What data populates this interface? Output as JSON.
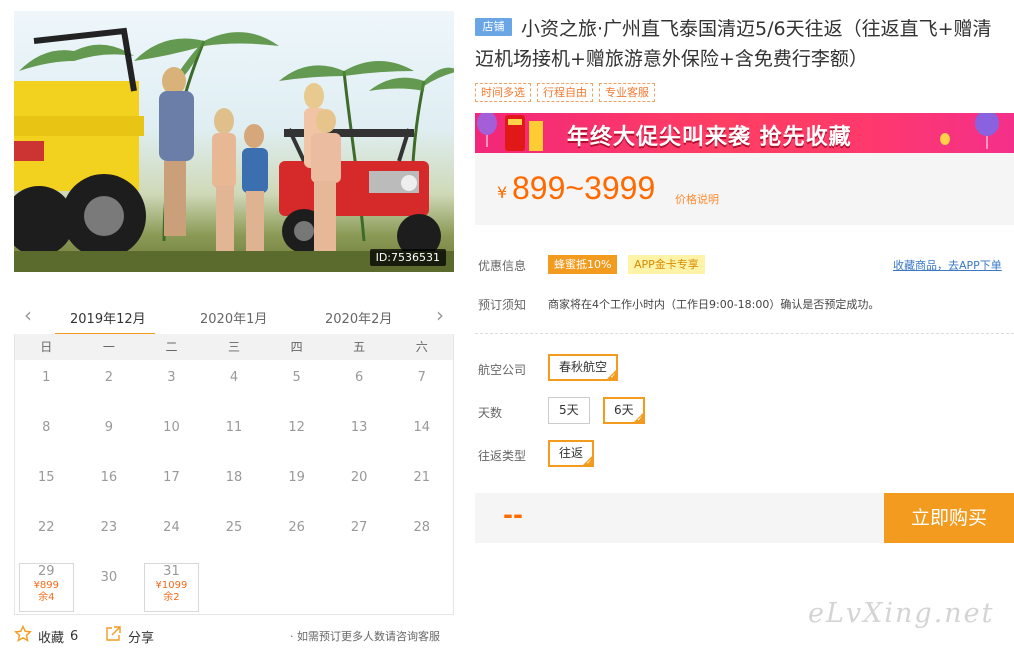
{
  "photo": {
    "id_label": "ID:7536531"
  },
  "calendar": {
    "months": [
      "2019年12月",
      "2020年1月",
      "2020年2月"
    ],
    "weekdays": [
      "日",
      "一",
      "二",
      "三",
      "四",
      "五",
      "六"
    ],
    "rows": [
      [
        {
          "d": "1"
        },
        {
          "d": "2"
        },
        {
          "d": "3"
        },
        {
          "d": "4"
        },
        {
          "d": "5"
        },
        {
          "d": "6"
        },
        {
          "d": "7"
        }
      ],
      [
        {
          "d": "8"
        },
        {
          "d": "9"
        },
        {
          "d": "10"
        },
        {
          "d": "11"
        },
        {
          "d": "12"
        },
        {
          "d": "13"
        },
        {
          "d": "14"
        }
      ],
      [
        {
          "d": "15"
        },
        {
          "d": "16"
        },
        {
          "d": "17"
        },
        {
          "d": "18"
        },
        {
          "d": "19"
        },
        {
          "d": "20"
        },
        {
          "d": "21"
        }
      ],
      [
        {
          "d": "22"
        },
        {
          "d": "23"
        },
        {
          "d": "24"
        },
        {
          "d": "25"
        },
        {
          "d": "26"
        },
        {
          "d": "27"
        },
        {
          "d": "28"
        }
      ],
      [
        {
          "d": "29",
          "price": "¥899",
          "stock": "余4"
        },
        {
          "d": "30"
        },
        {
          "d": "31",
          "price": "¥1099",
          "stock": "余2"
        },
        {
          "d": ""
        },
        {
          "d": ""
        },
        {
          "d": ""
        },
        {
          "d": ""
        }
      ]
    ]
  },
  "footer": {
    "favorite_label": "收藏",
    "favorite_count": "6",
    "share_label": "分享",
    "notice": "· 如需预订更多人数请咨询客服"
  },
  "product": {
    "shop_tag": "店铺",
    "title": "小资之旅·广州直飞泰国清迈5/6天往返（往返直飞+赠清迈机场接机+赠旅游意外保险+含免费行李额）",
    "tags": [
      "时间多选",
      "行程自由",
      "专业客服"
    ],
    "banner_text": "年终大促尖叫来袭  抢先收藏",
    "price_symbol": "¥",
    "price_range": "899~3999",
    "price_note": "价格说明",
    "promo_label": "优惠信息",
    "promo1": "蜂蜜抵10%",
    "promo2": "APP金卡专享",
    "app_link": "收藏商品，去APP下单",
    "booking_label": "预订须知",
    "booking_note": "商家将在4个工作小时内（工作日9:00-18:00）确认是否预定成功。",
    "airline_label": "航空公司",
    "airline_options": [
      "春秋航空"
    ],
    "days_label": "天数",
    "days_options": [
      "5天",
      "6天"
    ],
    "trip_label": "往返类型",
    "trip_options": [
      "往返"
    ],
    "buy_placeholder": "--",
    "buy_button": "立即购买"
  },
  "watermark": "eLvXing.net",
  "colors": {
    "accent": "#f39b1f",
    "price": "#ff6a00",
    "link": "#3a78c6",
    "banner": "#ff3e63"
  }
}
